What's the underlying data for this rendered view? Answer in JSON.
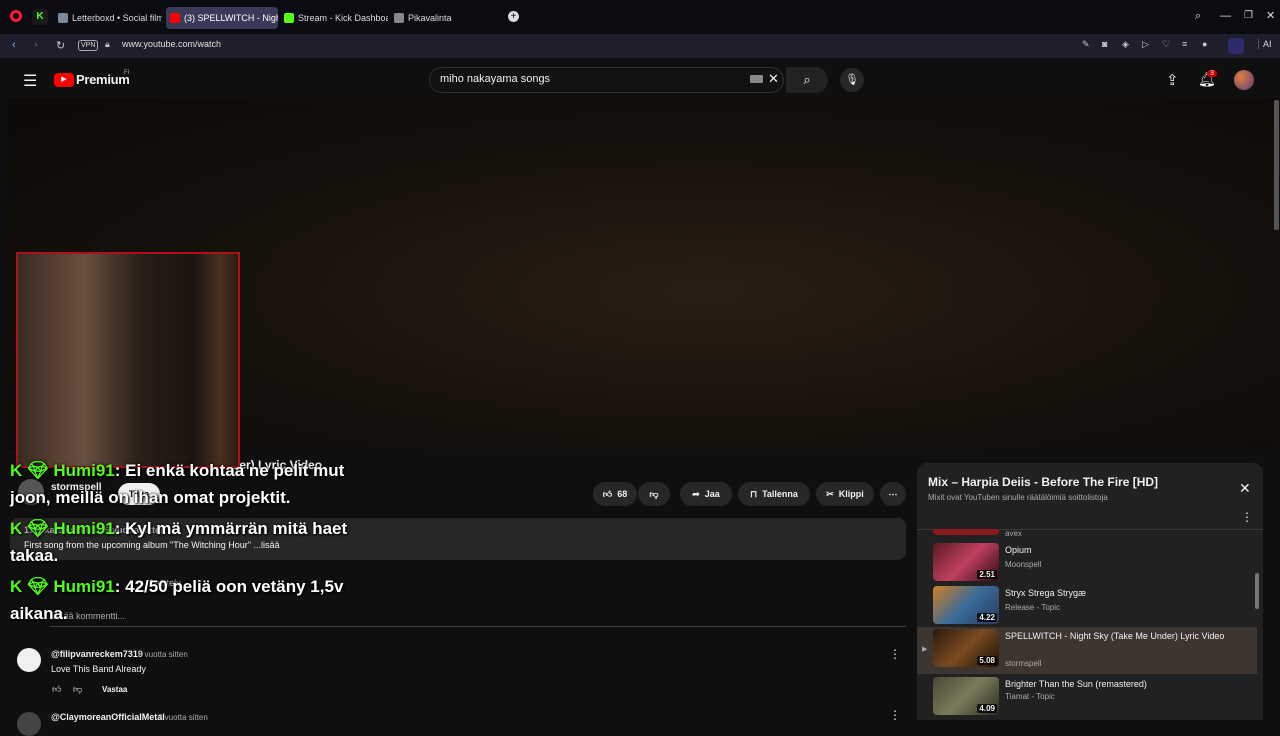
{
  "browser": {
    "tabs": [
      {
        "label": "Letterboxd • Social film di",
        "color": "#7a8a9a"
      },
      {
        "label": "(3) SPELLWITCH - Night Sk",
        "color": "#ff0000"
      },
      {
        "label": "Stream - Kick Dashboard",
        "color": "#53fc18"
      },
      {
        "label": "Pikavalinta",
        "color": "#888888"
      }
    ],
    "url": "www.youtube.com/watch",
    "vpn": "VPN",
    "ai": "AI"
  },
  "youtube": {
    "logo_text": "Premium",
    "region": "FI",
    "search_value": "miho nakayama songs",
    "notif_count": "3"
  },
  "video": {
    "title_tail": "der) Lyric Video",
    "channel": "stormspell",
    "subscribe": "Tilaa",
    "likes": "68",
    "share": "Jaa",
    "save": "Tallenna",
    "clip": "Klippi",
    "desc_line": "First song from the upcoming album \"The Witching Hour\" ...lisää",
    "desc_meta": "17 t. katselukertaa  6 vuotta sitten",
    "sort": "Lajittelu",
    "add_comment": "Lisää kommentti..."
  },
  "chat_overlay": [
    {
      "user": "Humi91",
      "text": ": Ei enkä kohtaa ne pelit mut"
    },
    {
      "user": "",
      "text": "joon, meillä on ihan omat projektit."
    },
    {
      "user": "Humi91",
      "text": ": Kyl mä ymmärrän mitä haet"
    },
    {
      "user": "",
      "text": "takaa."
    },
    {
      "user": "Humi91",
      "text": ": 42/50 peliä oon vetäny 1,5v"
    },
    {
      "user": "",
      "text": "aikana."
    }
  ],
  "comments": [
    {
      "author": "@filipvanreckem7319",
      "time": "8 vuotta sitten",
      "text": "Love This Band Already",
      "reply": "Vastaa"
    },
    {
      "author": "@ClaymoreanOfficialMetal",
      "time": "8 vuotta sitten",
      "text": "",
      "reply": ""
    }
  ],
  "mix": {
    "title": "Mix – Harpia Deiis - Before The Fire [HD]",
    "subtitle": "Mixit ovat YouTuben sinulle räätälöimiä soittolistoja",
    "prev_channel": "avex",
    "items": [
      {
        "title": "Opium",
        "channel": "Moonspell",
        "duration": "2.51",
        "active": false
      },
      {
        "title": "Stryx Strega Strygæ",
        "channel": "Release - Topic",
        "duration": "4.22",
        "active": false
      },
      {
        "title": "SPELLWITCH - Night Sky (Take Me Under) Lyric Video",
        "channel": "stormspell",
        "duration": "5.08",
        "active": true
      },
      {
        "title": "Brighter Than the Sun (remastered)",
        "channel": "Tiamat - Topic",
        "duration": "4.09",
        "active": false
      }
    ]
  },
  "colors": {
    "accent": "#ff0000",
    "kick": "#53fc18",
    "cam_border": "#b0101a"
  }
}
